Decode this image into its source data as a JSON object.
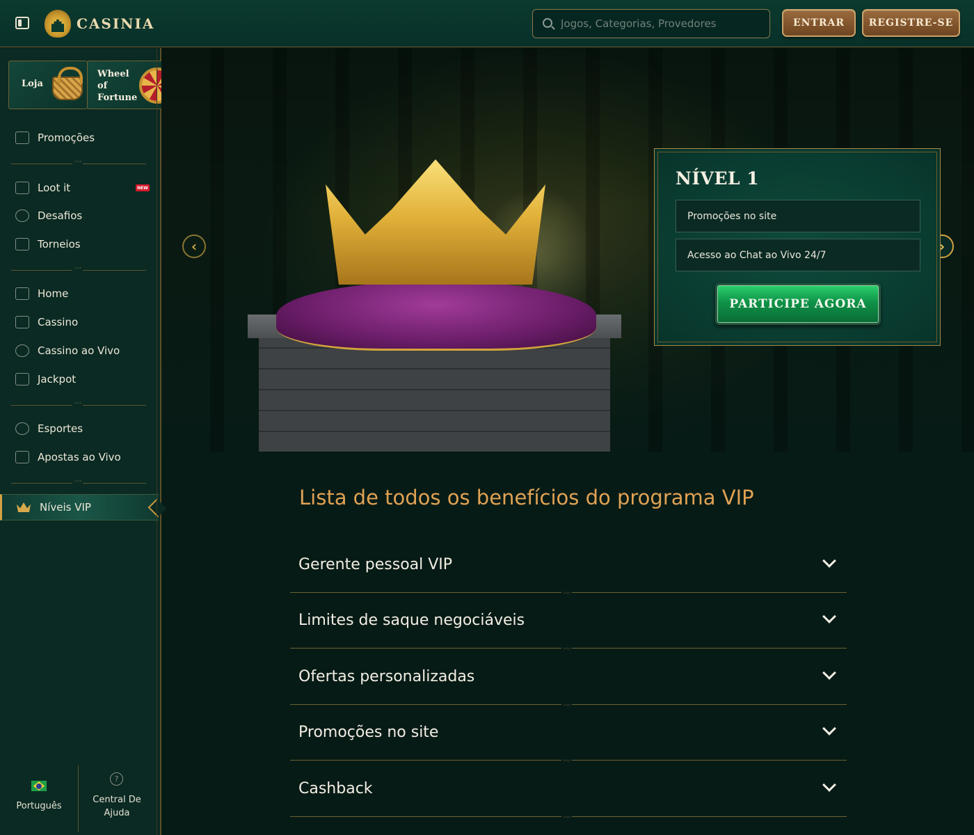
{
  "header": {
    "logo_text": "CASINIA",
    "search_placeholder": "Jogos, Categorias, Provedores",
    "login_label": "ENTRAR",
    "register_label": "REGISTRE-SE"
  },
  "sidebar": {
    "promo_cards": [
      {
        "label": "Loja",
        "icon": "basket-icon"
      },
      {
        "label": "Wheel of Fortune",
        "icon": "wheel-icon"
      }
    ],
    "items": [
      {
        "label": "Promoções",
        "icon": "gift-box-icon"
      },
      {
        "label": "Loot it",
        "icon": "chest-icon",
        "badge": "NEW"
      },
      {
        "label": "Desafios",
        "icon": "trophy-cup-icon"
      },
      {
        "label": "Torneios",
        "icon": "tournament-cup-icon"
      },
      {
        "label": "Home",
        "icon": "castle-icon"
      },
      {
        "label": "Cassino",
        "icon": "casino-building-icon"
      },
      {
        "label": "Cassino ao Vivo",
        "icon": "chip-icon"
      },
      {
        "label": "Jackpot",
        "icon": "seven-icon"
      },
      {
        "label": "Esportes",
        "icon": "soccer-ball-icon"
      },
      {
        "label": "Apostas ao Vivo",
        "icon": "live-shield-icon"
      },
      {
        "label": "Níveis VIP",
        "icon": "crown-icon",
        "active": true
      }
    ],
    "footer": {
      "language_label": "Português",
      "help_label": "Central De Ajuda"
    }
  },
  "hero": {
    "level_title": "NÍVEL 1",
    "perks": [
      "Promoções no site",
      "Acesso ao Chat ao Vivo 24/7"
    ],
    "cta_label": "PARTICIPE AGORA"
  },
  "benefits": {
    "title": "Lista de todos os benefícios do programa VIP",
    "items": [
      "Gerente pessoal VIP",
      "Limites de saque negociáveis",
      "Ofertas personalizadas",
      "Promoções no site",
      "Cashback"
    ]
  },
  "colors": {
    "background": "#071b16",
    "accent_gold": "#d4a341",
    "title_orange": "#e0a254",
    "cta_green": "#0f9247",
    "button_brown": "#7e532b",
    "new_badge": "#d51a2b"
  }
}
